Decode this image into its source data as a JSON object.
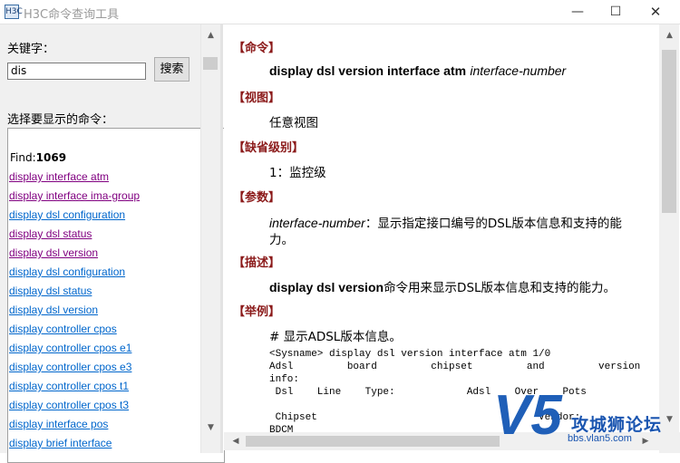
{
  "window": {
    "app_icon": "H3C",
    "title": "H3C命令查询工具",
    "controls": {
      "minimize": "—",
      "maximize": "☐",
      "close": "✕"
    }
  },
  "left": {
    "keyword_label": "关键字：",
    "search_value": "dis",
    "search_button": "搜索",
    "choose_label": "选择要显示的命令：",
    "find_label": "Find:",
    "find_count": "1069",
    "commands": [
      {
        "text": "display interface atm",
        "visited": true
      },
      {
        "text": "display interface ima-group",
        "visited": true
      },
      {
        "text": "display dsl configuration",
        "visited": false
      },
      {
        "text": "display dsl status",
        "visited": true
      },
      {
        "text": "display dsl version",
        "visited": true
      },
      {
        "text": "display dsl configuration",
        "visited": false
      },
      {
        "text": "display dsl status",
        "visited": false
      },
      {
        "text": "display dsl version",
        "visited": false
      },
      {
        "text": "display controller cpos",
        "visited": false
      },
      {
        "text": "display controller cpos e1",
        "visited": false
      },
      {
        "text": "display controller cpos e3",
        "visited": false
      },
      {
        "text": "display controller cpos t1",
        "visited": false
      },
      {
        "text": "display controller cpos t3",
        "visited": false
      },
      {
        "text": "display interface pos",
        "visited": false
      },
      {
        "text": "display brief interface",
        "visited": false
      }
    ]
  },
  "right": {
    "sec_command": "【命令】",
    "command_name": "display dsl version interface atm",
    "command_param": "interface-number",
    "sec_view": "【视图】",
    "view_value": "任意视图",
    "sec_level": "【缺省级别】",
    "level_value": "1：监控级",
    "sec_params": "【参数】",
    "param_name": "interface-number",
    "param_desc_1": "：显示指定接口编号的DSL版本信息和支持的能",
    "param_desc_2": "力。",
    "sec_desc": "【描述】",
    "desc_cmd": "display dsl version",
    "desc_text": "命令用来显示DSL版本信息和支持的能力。",
    "sec_example": "【举例】",
    "example_title": "# 显示ADSL版本信息。",
    "example_code": "<Sysname> display dsl version interface atm 1/0\nAdsl         board         chipset         and         version\ninfo:\n Dsl    Line    Type:            Adsl    Over    Pots\n\n Chipset                                     Vendor:\nBDCM"
  },
  "watermark": {
    "logo_letter": "V5",
    "brand": "攻城狮论坛",
    "url": "bbs.vlan5.com"
  }
}
